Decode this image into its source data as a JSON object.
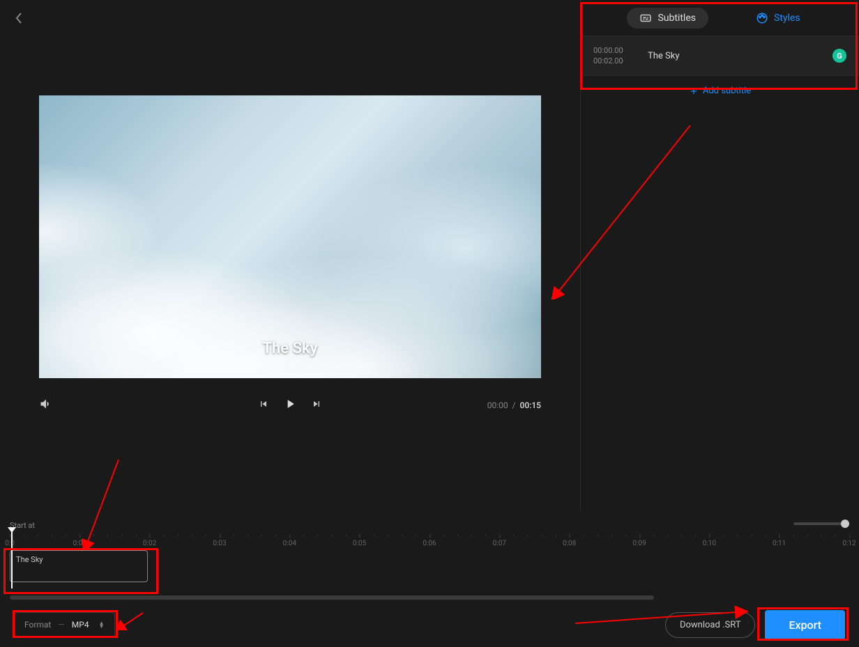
{
  "tabs": {
    "subtitles": "Subtitles",
    "styles": "Styles"
  },
  "subtitle_entry": {
    "start_time": "00:00.00",
    "end_time": "00:02.00",
    "text": "The Sky",
    "badge_letter": "G"
  },
  "add_subtitle_label": "Add subtitle",
  "preview_subtitle": "The Sky",
  "player": {
    "current_time": "00:00",
    "total_time": "00:15",
    "separator": "/"
  },
  "timeline": {
    "start_label": "Start at",
    "ticks": [
      "0:0",
      "0:01",
      "0:02",
      "0:03",
      "0:04",
      "0:05",
      "0:06",
      "0:07",
      "0:08",
      "0:09",
      "0:10",
      "0:11",
      "0:12"
    ],
    "clip_text": "The Sky"
  },
  "format": {
    "label": "Format",
    "value": "MP4"
  },
  "buttons": {
    "download_srt": "Download .SRT",
    "export": "Export"
  }
}
